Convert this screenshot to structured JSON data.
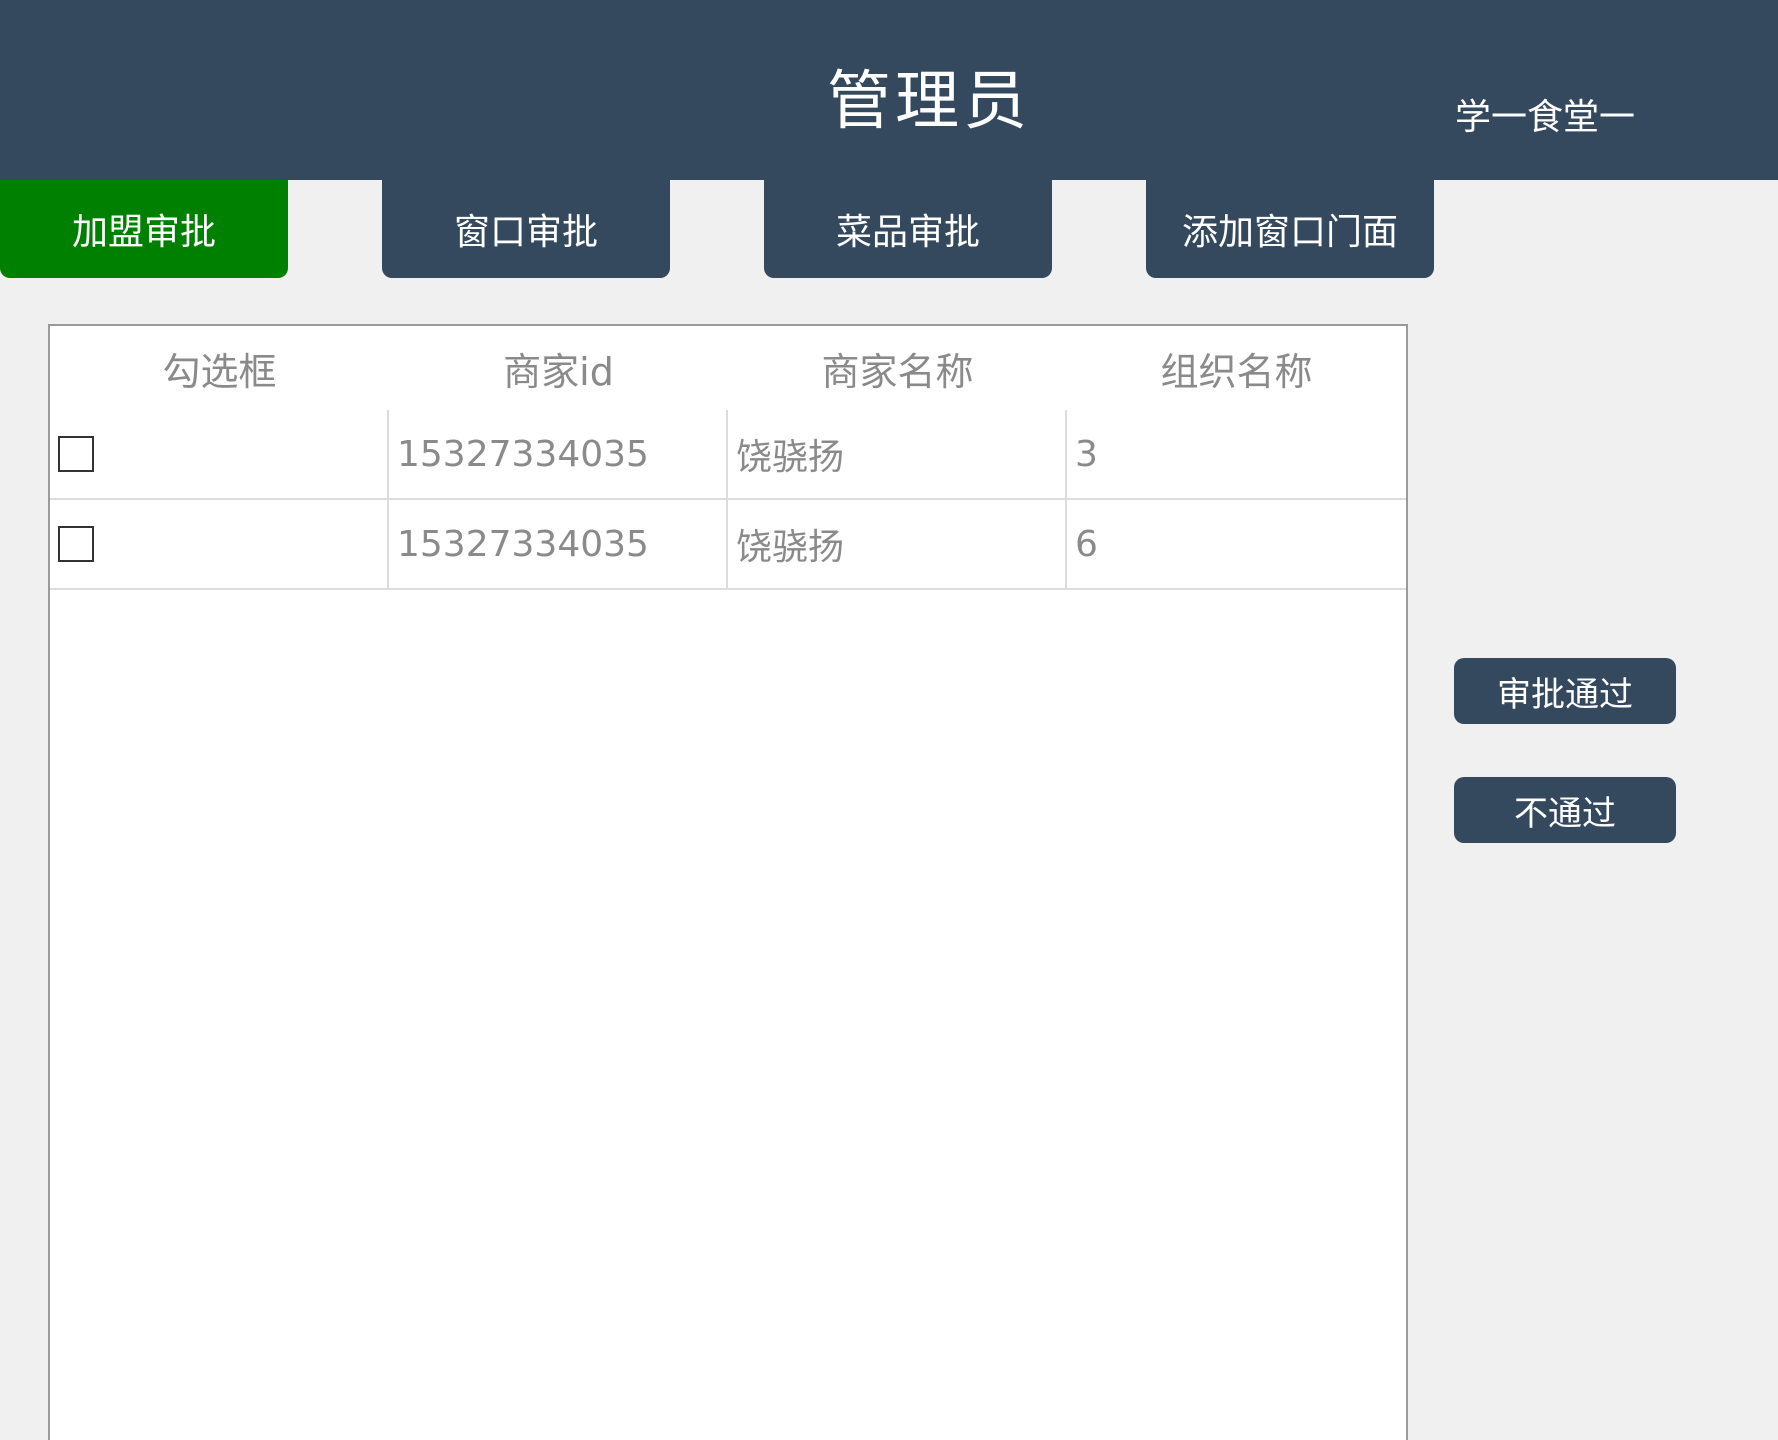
{
  "header": {
    "title": "管理员",
    "user_label": "学一食堂一"
  },
  "tabs": [
    {
      "label": "加盟审批",
      "active": true
    },
    {
      "label": "窗口审批",
      "active": false
    },
    {
      "label": "菜品审批",
      "active": false
    },
    {
      "label": "添加窗口门面",
      "active": false
    }
  ],
  "table": {
    "columns": [
      "勾选框",
      "商家id",
      "商家名称",
      "组织名称"
    ],
    "rows": [
      {
        "checked": false,
        "merchant_id": "15327334035",
        "merchant_name": "饶骁扬",
        "org_name": "3"
      },
      {
        "checked": false,
        "merchant_id": "15327334035",
        "merchant_name": "饶骁扬",
        "org_name": "6"
      }
    ]
  },
  "actions": {
    "approve_label": "审批通过",
    "reject_label": "不通过"
  },
  "colors": {
    "header_bg": "#34495e",
    "active_tab": "#008000",
    "page_bg": "#f0f0f0"
  }
}
